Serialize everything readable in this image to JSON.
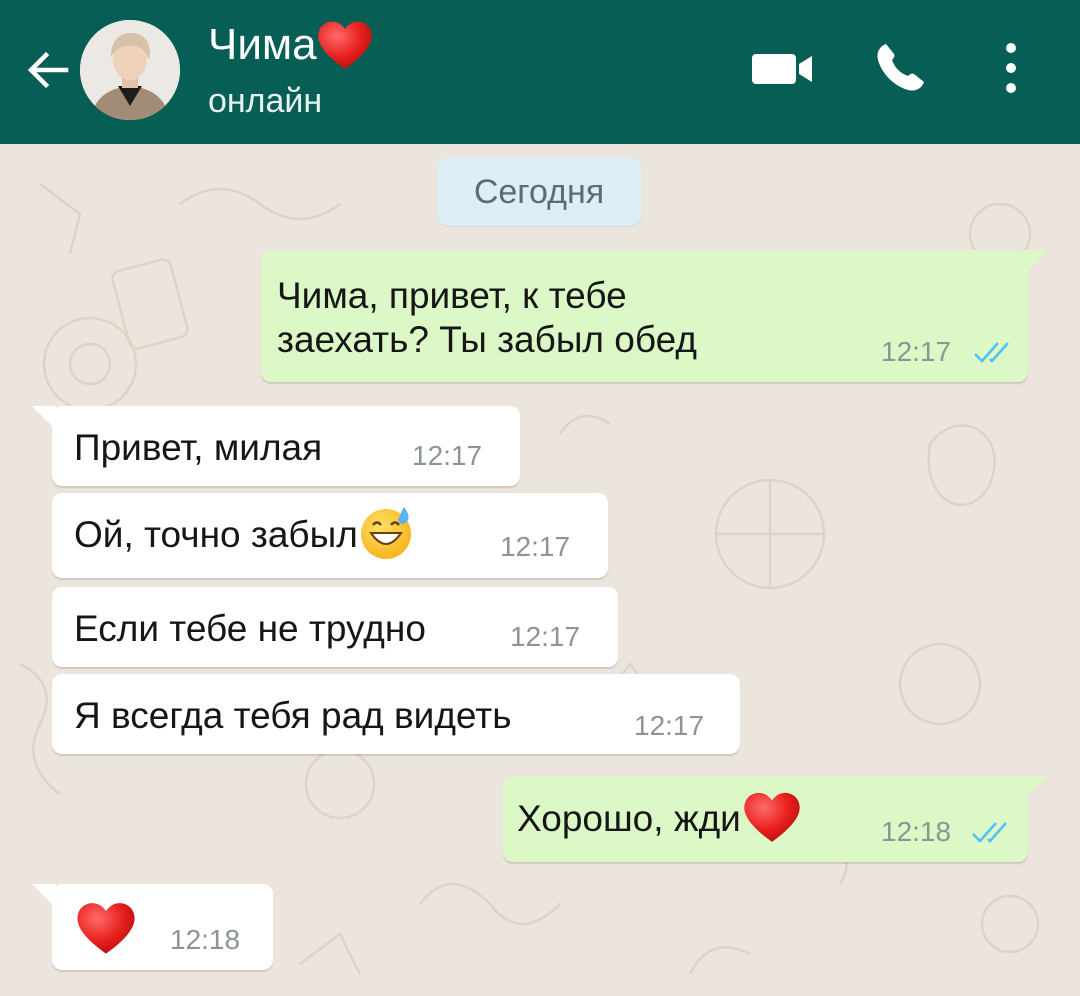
{
  "header": {
    "contact_name": "Чима",
    "status": "онлайн",
    "icons": [
      "back-arrow-icon",
      "avatar",
      "red-heart-emoji",
      "video-camera-icon",
      "phone-icon",
      "more-vertical-icon"
    ]
  },
  "chat": {
    "date_chip": "Сегодня",
    "messages": [
      {
        "direction": "outgoing",
        "lines": [
          "Чима, привет, к тебе",
          "заехать? Ты забыл обед"
        ],
        "time": "12:17",
        "read": true
      },
      {
        "direction": "incoming",
        "text": "Привет, милая",
        "time": "12:17"
      },
      {
        "direction": "incoming",
        "text": "Ой, точно забыл",
        "emoji": "grinning-sweat-emoji",
        "time": "12:17"
      },
      {
        "direction": "incoming",
        "text": "Если тебе не трудно",
        "time": "12:17"
      },
      {
        "direction": "incoming",
        "text": "Я всегда тебя рад видеть",
        "time": "12:17"
      },
      {
        "direction": "outgoing",
        "text": "Хорошо, жди",
        "emoji": "red-heart-emoji",
        "time": "12:18",
        "read": true
      },
      {
        "direction": "incoming",
        "text": "",
        "emoji": "red-heart-emoji",
        "time": "12:18"
      }
    ]
  },
  "colors": {
    "header": "#075e54",
    "chat_background": "#ece5dd",
    "outgoing_bubble": "#dcf8c6",
    "incoming_bubble": "#ffffff",
    "read_ticks": "#4fc3f7",
    "date_chip": "#dceff7"
  }
}
